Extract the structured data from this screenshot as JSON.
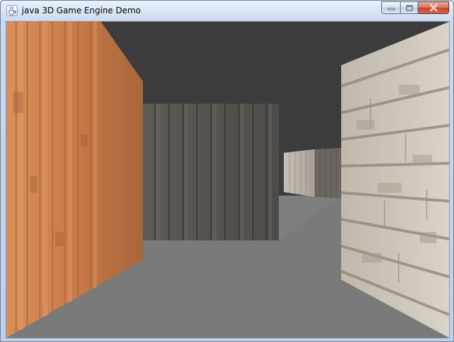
{
  "window": {
    "title": "java 3D Game Engine Demo",
    "icon": "java-coffee-cup-icon",
    "controls": [
      "minimize-icon",
      "maximize-icon",
      "close-icon"
    ]
  },
  "scene": {
    "ceiling_color": "#3b3b3b",
    "floor_color": "#7a7a7a",
    "textures": [
      "orange-wood-planks",
      "dark-grey-wood-planks",
      "light-wood-planks",
      "pale-stone-bricks"
    ]
  }
}
